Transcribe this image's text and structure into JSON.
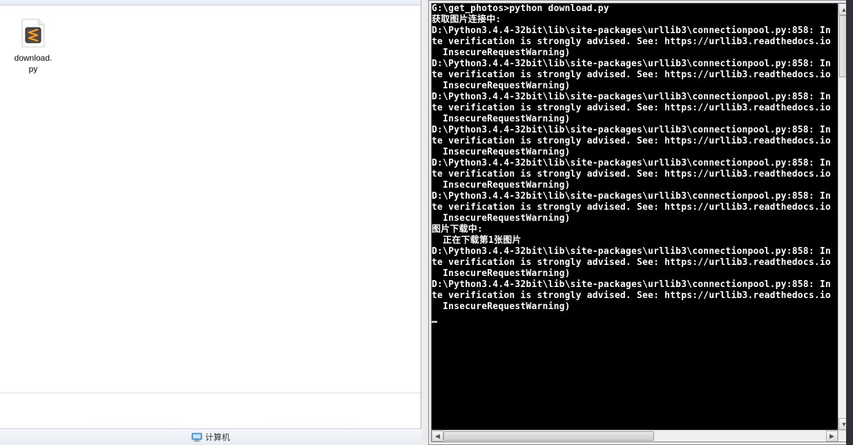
{
  "explorer": {
    "file": {
      "name_line1": "download.",
      "name_line2": "py"
    },
    "statusbar": {
      "icon_name": "computer-icon",
      "label": "计算机"
    }
  },
  "terminal": {
    "lines": [
      "",
      "G:\\get_photos>python download.py",
      "获取图片连接中:",
      "D:\\Python3.4.4-32bit\\lib\\site-packages\\urllib3\\connectionpool.py:858: In",
      "te verification is strongly advised. See: https://urllib3.readthedocs.io",
      "  InsecureRequestWarning)",
      "D:\\Python3.4.4-32bit\\lib\\site-packages\\urllib3\\connectionpool.py:858: In",
      "te verification is strongly advised. See: https://urllib3.readthedocs.io",
      "  InsecureRequestWarning)",
      "D:\\Python3.4.4-32bit\\lib\\site-packages\\urllib3\\connectionpool.py:858: In",
      "te verification is strongly advised. See: https://urllib3.readthedocs.io",
      "  InsecureRequestWarning)",
      "D:\\Python3.4.4-32bit\\lib\\site-packages\\urllib3\\connectionpool.py:858: In",
      "te verification is strongly advised. See: https://urllib3.readthedocs.io",
      "  InsecureRequestWarning)",
      "D:\\Python3.4.4-32bit\\lib\\site-packages\\urllib3\\connectionpool.py:858: In",
      "te verification is strongly advised. See: https://urllib3.readthedocs.io",
      "  InsecureRequestWarning)",
      "D:\\Python3.4.4-32bit\\lib\\site-packages\\urllib3\\connectionpool.py:858: In",
      "te verification is strongly advised. See: https://urllib3.readthedocs.io",
      "  InsecureRequestWarning)",
      "图片下载中:",
      "  正在下载第1张图片",
      "D:\\Python3.4.4-32bit\\lib\\site-packages\\urllib3\\connectionpool.py:858: In",
      "te verification is strongly advised. See: https://urllib3.readthedocs.io",
      "  InsecureRequestWarning)",
      "D:\\Python3.4.4-32bit\\lib\\site-packages\\urllib3\\connectionpool.py:858: In",
      "te verification is strongly advised. See: https://urllib3.readthedocs.io",
      "  InsecureRequestWarning)"
    ]
  }
}
